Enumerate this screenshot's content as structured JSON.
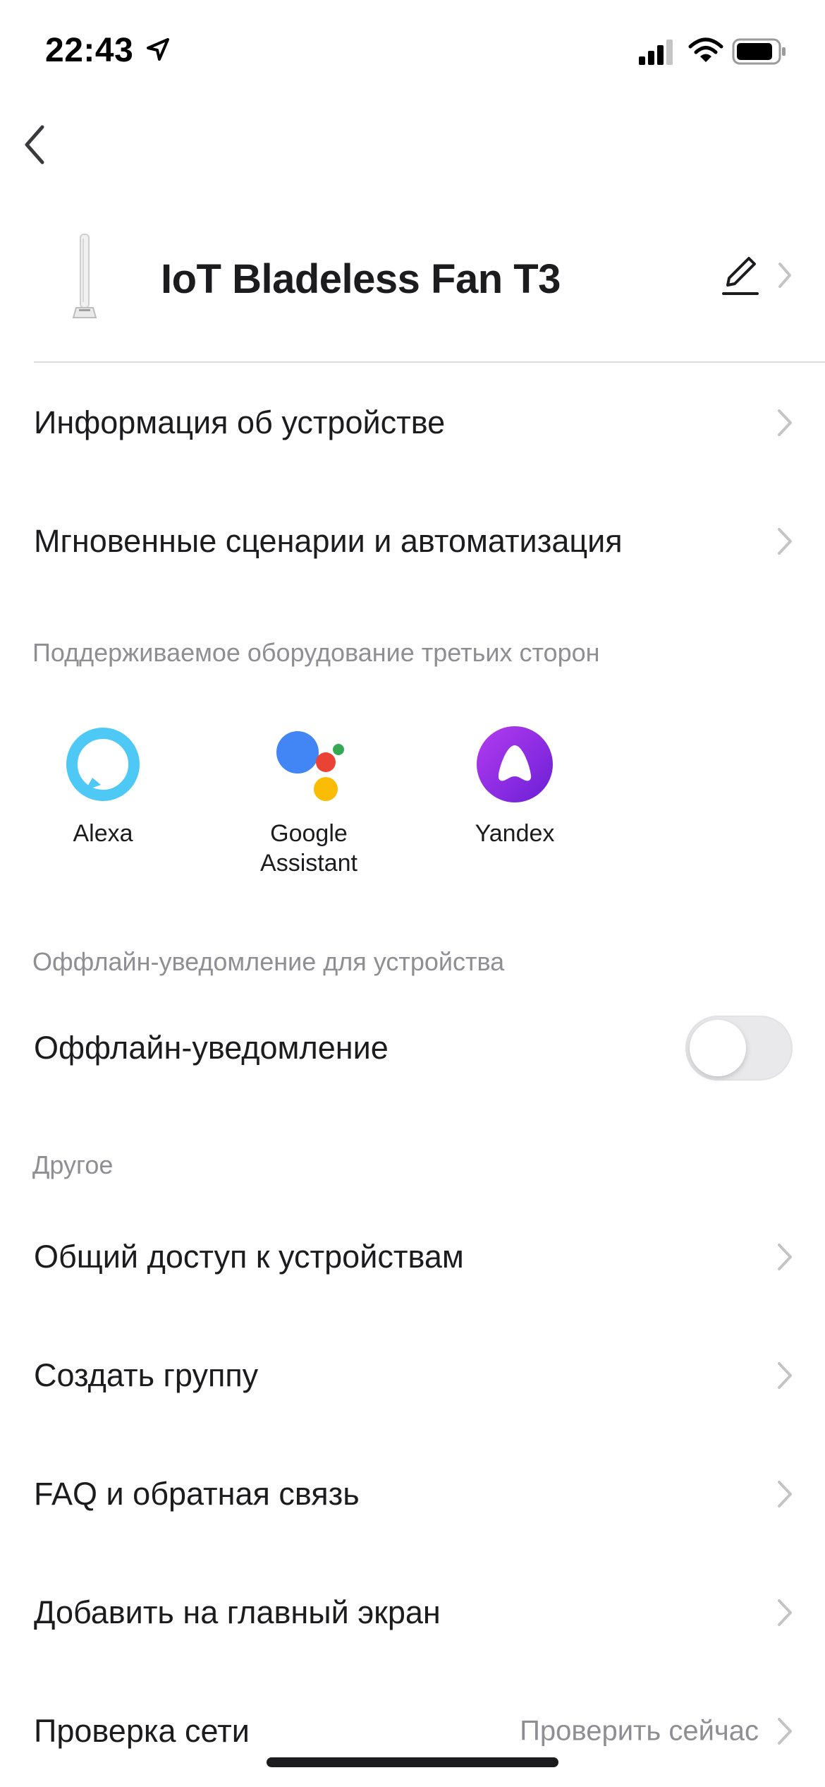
{
  "status_bar": {
    "time": "22:43",
    "icons": [
      "location-arrow-icon",
      "cellular-signal-icon",
      "wifi-icon",
      "battery-icon"
    ]
  },
  "nav": {
    "back_icon": "chevron-left-icon"
  },
  "device": {
    "name": "IoT Bladeless Fan T3",
    "image_icon": "tower-fan-icon",
    "edit_icon": "pencil-icon"
  },
  "menu_top": [
    {
      "label": "Информация об устройстве"
    },
    {
      "label": "Мгновенные сценарии и автоматизация"
    }
  ],
  "third_party": {
    "title": "Поддерживаемое оборудование третьих сторон",
    "assistants": [
      {
        "name": "Alexa",
        "icon": "alexa-icon"
      },
      {
        "name": "Google\nAssistant",
        "icon": "google-assistant-icon"
      },
      {
        "name": "Yandex",
        "icon": "yandex-alice-icon"
      }
    ]
  },
  "offline": {
    "title": "Оффлайн-уведомление для устройства",
    "label": "Оффлайн-уведомление",
    "enabled": false
  },
  "other": {
    "title": "Другое",
    "items": [
      {
        "label": "Общий доступ к устройствам"
      },
      {
        "label": "Создать группу"
      },
      {
        "label": "FAQ и обратная связь"
      },
      {
        "label": "Добавить на главный экран"
      },
      {
        "label": "Проверка сети",
        "value": "Проверить сейчас"
      }
    ]
  },
  "colors": {
    "alexa": "#4ec8f4",
    "google_blue": "#4285f4",
    "google_red": "#ea4335",
    "google_yellow": "#fbbc05",
    "google_green": "#34a853",
    "yandex_purple": "#8c2be2",
    "secondary_text": "#8e8e93"
  }
}
